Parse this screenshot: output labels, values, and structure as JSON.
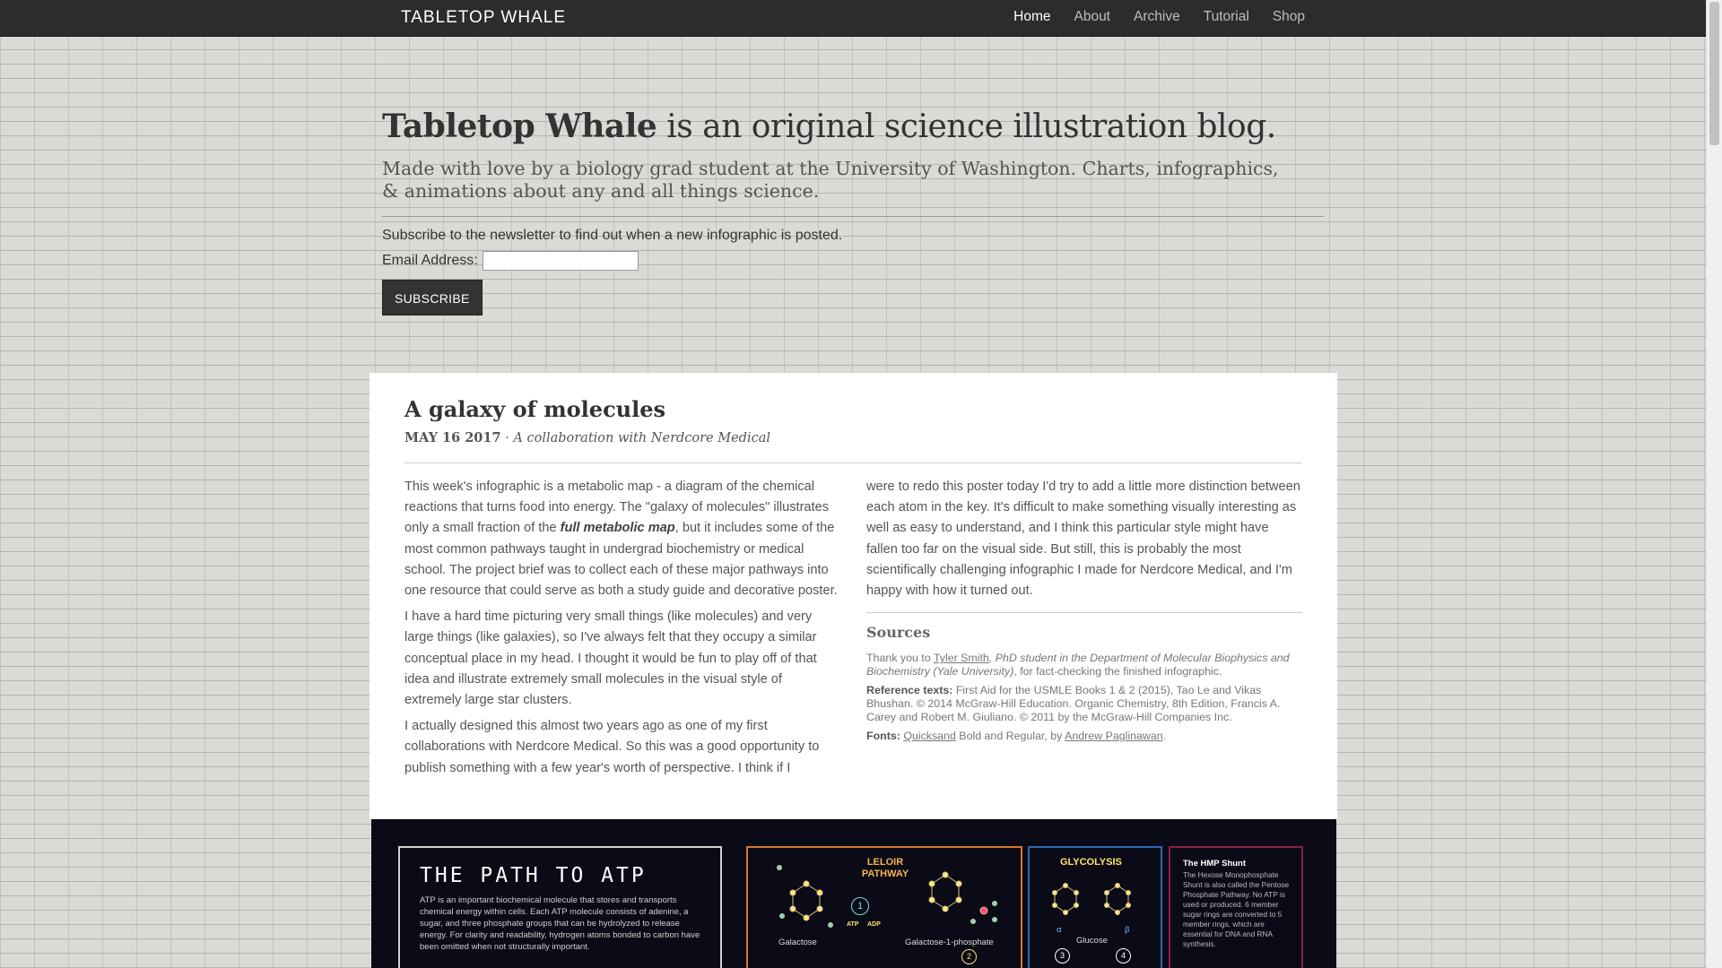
{
  "navbar": {
    "brand": "TABLETOP WHALE",
    "links": [
      "Home",
      "About",
      "Archive",
      "Tutorial",
      "Shop"
    ],
    "active": "Home"
  },
  "hero": {
    "title_bold": "Tabletop Whale",
    "title_rest": " is an original science illustration blog.",
    "subtitle": "Made with love by a biology grad student at the University of Washington. Charts, infographics, & animations about any and all things science.",
    "newsletter_text": "Subscribe to the newsletter to find out when a new infographic is posted.",
    "email_label": "Email Address:",
    "email_value": "",
    "subscribe_label": "SUBSCRIBE"
  },
  "post": {
    "title": "A galaxy of molecules",
    "date": "MAY 16 2017",
    "separator": " · ",
    "collab": "A collaboration with Nerdcore Medical",
    "p1_a": "This week's infographic is a metabolic map - a diagram of the chemical reactions that turns food into energy. The \"galaxy of molecules\" illustrates only a small fraction of the ",
    "p1_link": "full metabolic map",
    "p1_b": ", but it includes some of the most common pathways taught in undergrad biochemistry or medical school. The project brief was to collect each of these major pathways into one resource that could serve as both a study guide and decorative poster.",
    "p2": "I have a hard time picturing very small things (like molecules) and very large things (like galaxies), so I've always felt that they occupy a similar conceptual place in my head. I thought it would be fun to play off of that idea and illustrate extremely small molecules in the visual style of extremely large star clusters.",
    "p3": "I actually designed this almost two years ago as one of my first collaborations with Nerdcore Medical. So this was a good opportunity to publish something with a few year's worth of perspective. I think if I",
    "p4": "were to redo this poster today I'd try to add a little more distinction between each atom in the key. It's difficult to make something visually interesting as well as easy to understand, and I think this particular style might have fallen too far on the visual side. But still, this is probably the most scientifically challenging infographic I made for Nerdcore Medical, and I'm happy with how it turned out.",
    "sources_heading": "Sources",
    "thanks_a": "Thank you to ",
    "thanks_link": "Tyler Smith",
    "thanks_role": ", PhD student in the Department of Molecular Biophysics and Biochemistry (Yale University)",
    "thanks_b": ", for fact-checking the finished infographic.",
    "ref_label": "Reference texts:",
    "ref_text": " First Aid for the USMLE Books 1 & 2 (2015), Tao Le and Vikas Bhushan. © 2014 McGraw-Hill Education. Organic Chemistry, 8th Edition, Francis A. Carey and Robert M. Giuliano. © 2011 by the McGraw-Hill Companies Inc.",
    "fonts_label": "Fonts:",
    "fonts_link1": "Quicksand",
    "fonts_mid": " Bold and Regular, by ",
    "fonts_link2": "Andrew Paglinawan",
    "fonts_end": "."
  },
  "poster": {
    "panel1_title": "THE PATH TO ATP",
    "panel1_text": "ATP is an important biochemical molecule that stores and transports chemical energy within cells. Each ATP molecule consists of adenine, a sugar, and three phosphate groups that can be hydrolyzed to release energy. For clarity and readability, hydrogen atoms bonded to carbon have been omitted when not structurally important.",
    "leloir_line1": "LELOIR",
    "leloir_line2": "PATHWAY",
    "galactose": "Galactose",
    "galactose_1p": "Galactose-1-phosphate",
    "atp": "ATP",
    "adp": "ADP",
    "step1": "1",
    "step2": "2",
    "glycolysis": "GLYCOLYSIS",
    "alpha": "α",
    "beta": "β",
    "glucose": "Glucose",
    "step3": "3",
    "step4": "4",
    "hmp_title": "The HMP Shunt",
    "hmp_text": "The Hexose Monophosphate Shunt is also called the Pentose Phosphate Pathway. No ATP is used or produced. 6 member sugar rings are converted to 5 member rings, which are essential for DNA and RNA synthesis."
  },
  "colors": {
    "navbar": "#2c2c2c",
    "leloir_border": "#d67a2a",
    "glycolysis_border": "#2d6bb0",
    "hmp_border": "#8a2040",
    "poster_bg": "#0b0a17"
  }
}
